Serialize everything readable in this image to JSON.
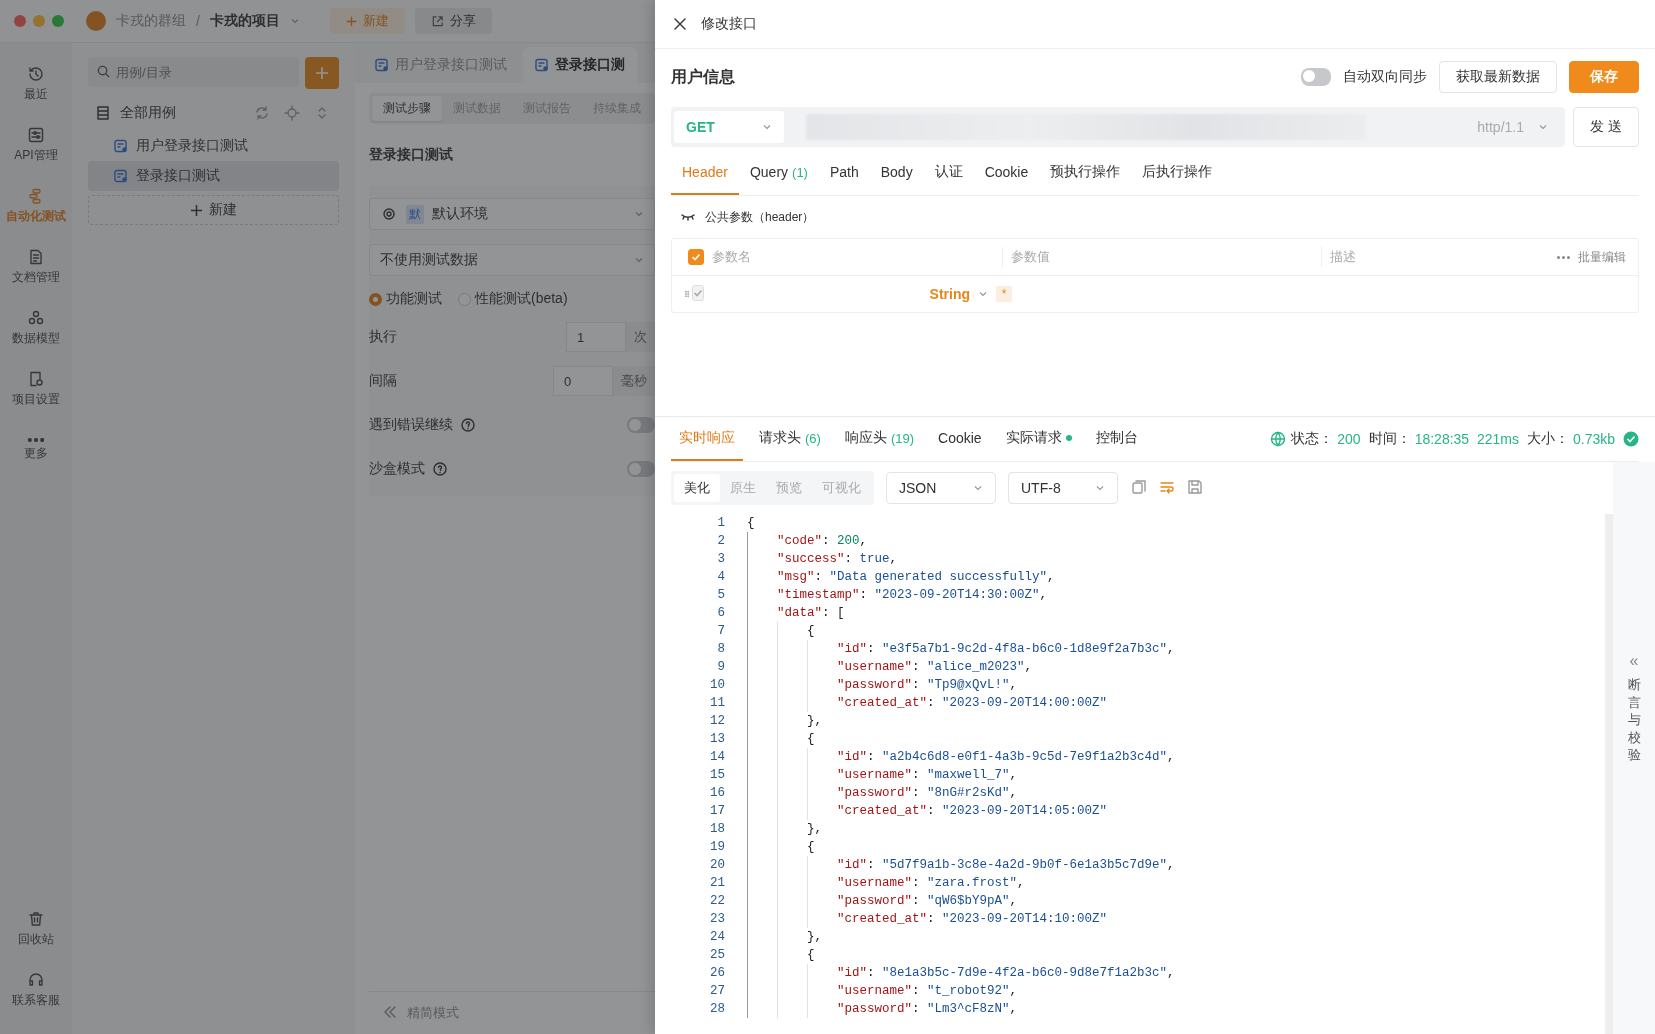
{
  "titlebar": {
    "group": "卡戎的群组",
    "separator": "/",
    "project": "卡戎的项目",
    "new_button": "新建",
    "share_button": "分享"
  },
  "nav": [
    {
      "label": "最近",
      "selected": false
    },
    {
      "label": "API管理",
      "selected": false
    },
    {
      "label": "自动化测试",
      "selected": true
    },
    {
      "label": "文档管理",
      "selected": false
    },
    {
      "label": "数据模型",
      "selected": false
    },
    {
      "label": "项目设置",
      "selected": false
    },
    {
      "label": "更多",
      "selected": false
    }
  ],
  "nav_bottom": [
    {
      "label": "回收站"
    },
    {
      "label": "联系客服"
    }
  ],
  "tree": {
    "search": {
      "placeholder": "用例/目录"
    },
    "root": "全部用例",
    "items": [
      {
        "label": "用户登录接口测试",
        "selected": false
      },
      {
        "label": "登录接口测试",
        "selected": true
      }
    ],
    "new_button": "新建"
  },
  "main": {
    "tabs": [
      {
        "label": "用户登录接口测试",
        "selected": false
      },
      {
        "label": "登录接口测",
        "selected": true
      }
    ],
    "subtabs": [
      {
        "label": "测试步骤",
        "selected": true
      },
      {
        "label": "测试数据",
        "selected": false
      },
      {
        "label": "测试报告",
        "selected": false
      },
      {
        "label": "持续集成",
        "selected": false
      }
    ],
    "title": "登录接口测试",
    "env_badge": "默",
    "env": "默认环境",
    "test_data": "不使用测试数据",
    "modes": [
      {
        "label": "功能测试",
        "selected": true
      },
      {
        "label": "性能测试(beta)",
        "selected": false
      }
    ],
    "fields": [
      {
        "label": "执行",
        "value": "1",
        "unit": "次"
      },
      {
        "label": "间隔",
        "value": "0",
        "unit": "毫秒"
      }
    ],
    "switches": [
      {
        "label": "遇到错误继续",
        "on": false
      },
      {
        "label": "沙盒模式",
        "on": false
      }
    ],
    "footer": "精简模式"
  },
  "drawer": {
    "title": "修改接口",
    "api_name": "用户信息",
    "auto_sync": {
      "label": "自动双向同步",
      "on": false
    },
    "fetch_button": "获取最新数据",
    "save_button": "保存",
    "method": "GET",
    "protocol": "http/1.1",
    "send_button": "发 送",
    "request_tabs": [
      {
        "label": "Header",
        "selected": true
      },
      {
        "label": "Query",
        "count": "(1)",
        "selected": false
      },
      {
        "label": "Path",
        "selected": false
      },
      {
        "label": "Body",
        "selected": false
      },
      {
        "label": "认证",
        "selected": false
      },
      {
        "label": "Cookie",
        "selected": false
      },
      {
        "label": "预执行操作",
        "selected": false
      },
      {
        "label": "后执行操作",
        "selected": false
      }
    ],
    "public_params": "公共参数（header）",
    "param_table": {
      "columns": [
        "参数名",
        "参数值",
        "描述"
      ],
      "all_checked": true,
      "batch_edit": "批量编辑",
      "rows": [
        {
          "checked": true,
          "type": "String",
          "required": "*"
        }
      ]
    },
    "response_tabs": [
      {
        "label": "实时响应",
        "selected": true
      },
      {
        "label": "请求头",
        "count": "(6)",
        "selected": false
      },
      {
        "label": "响应头",
        "count": "(19)",
        "selected": false
      },
      {
        "label": "Cookie",
        "selected": false
      },
      {
        "label": "实际请求",
        "dot": true,
        "selected": false
      },
      {
        "label": "控制台",
        "selected": false
      }
    ],
    "status": [
      {
        "label": "状态：",
        "value": "200"
      },
      {
        "label": "时间：",
        "value": "18:28:35  221ms"
      },
      {
        "label": "大小：",
        "value": "0.73kb"
      }
    ],
    "view_modes": [
      {
        "label": "美化",
        "selected": true
      },
      {
        "label": "原生",
        "selected": false
      },
      {
        "label": "预览",
        "selected": false
      },
      {
        "label": "可视化",
        "selected": false
      }
    ],
    "format": "JSON",
    "encoding": "UTF-8",
    "code_lines": [
      {
        "n": "1",
        "text": "{"
      },
      {
        "n": "2",
        "text": "    \"code\": 200,"
      },
      {
        "n": "3",
        "text": "    \"success\": true,"
      },
      {
        "n": "4",
        "text": "    \"msg\": \"Data generated successfully\","
      },
      {
        "n": "5",
        "text": "    \"timestamp\": \"2023-09-20T14:30:00Z\","
      },
      {
        "n": "6",
        "text": "    \"data\": ["
      },
      {
        "n": "7",
        "text": "        {"
      },
      {
        "n": "8",
        "text": "            \"id\": \"e3f5a7b1-9c2d-4f8a-b6c0-1d8e9f2a7b3c\","
      },
      {
        "n": "9",
        "text": "            \"username\": \"alice_m2023\","
      },
      {
        "n": "10",
        "text": "            \"password\": \"Tp9@xQvL!\","
      },
      {
        "n": "11",
        "text": "            \"created_at\": \"2023-09-20T14:00:00Z\""
      },
      {
        "n": "12",
        "text": "        },"
      },
      {
        "n": "13",
        "text": "        {"
      },
      {
        "n": "14",
        "text": "            \"id\": \"a2b4c6d8-e0f1-4a3b-9c5d-7e9f1a2b3c4d\","
      },
      {
        "n": "15",
        "text": "            \"username\": \"maxwell_7\","
      },
      {
        "n": "16",
        "text": "            \"password\": \"8nG#r2sKd\","
      },
      {
        "n": "17",
        "text": "            \"created_at\": \"2023-09-20T14:05:00Z\""
      },
      {
        "n": "18",
        "text": "        },"
      },
      {
        "n": "19",
        "text": "        {"
      },
      {
        "n": "20",
        "text": "            \"id\": \"5d7f9a1b-3c8e-4a2d-9b0f-6e1a3b5c7d9e\","
      },
      {
        "n": "21",
        "text": "            \"username\": \"zara.frost\","
      },
      {
        "n": "22",
        "text": "            \"password\": \"qW6$bY9pA\","
      },
      {
        "n": "23",
        "text": "            \"created_at\": \"2023-09-20T14:10:00Z\""
      },
      {
        "n": "24",
        "text": "        },"
      },
      {
        "n": "25",
        "text": "        {"
      },
      {
        "n": "26",
        "text": "            \"id\": \"8e1a3b5c-7d9e-4f2a-b6c0-9d8e7f1a2b3c\","
      },
      {
        "n": "27",
        "text": "            \"username\": \"t_robot92\","
      },
      {
        "n": "28",
        "text": "            \"password\": \"Lm3^cF8zN\","
      }
    ],
    "side_panel": {
      "arrow": "«",
      "label": "断言与校验"
    }
  }
}
